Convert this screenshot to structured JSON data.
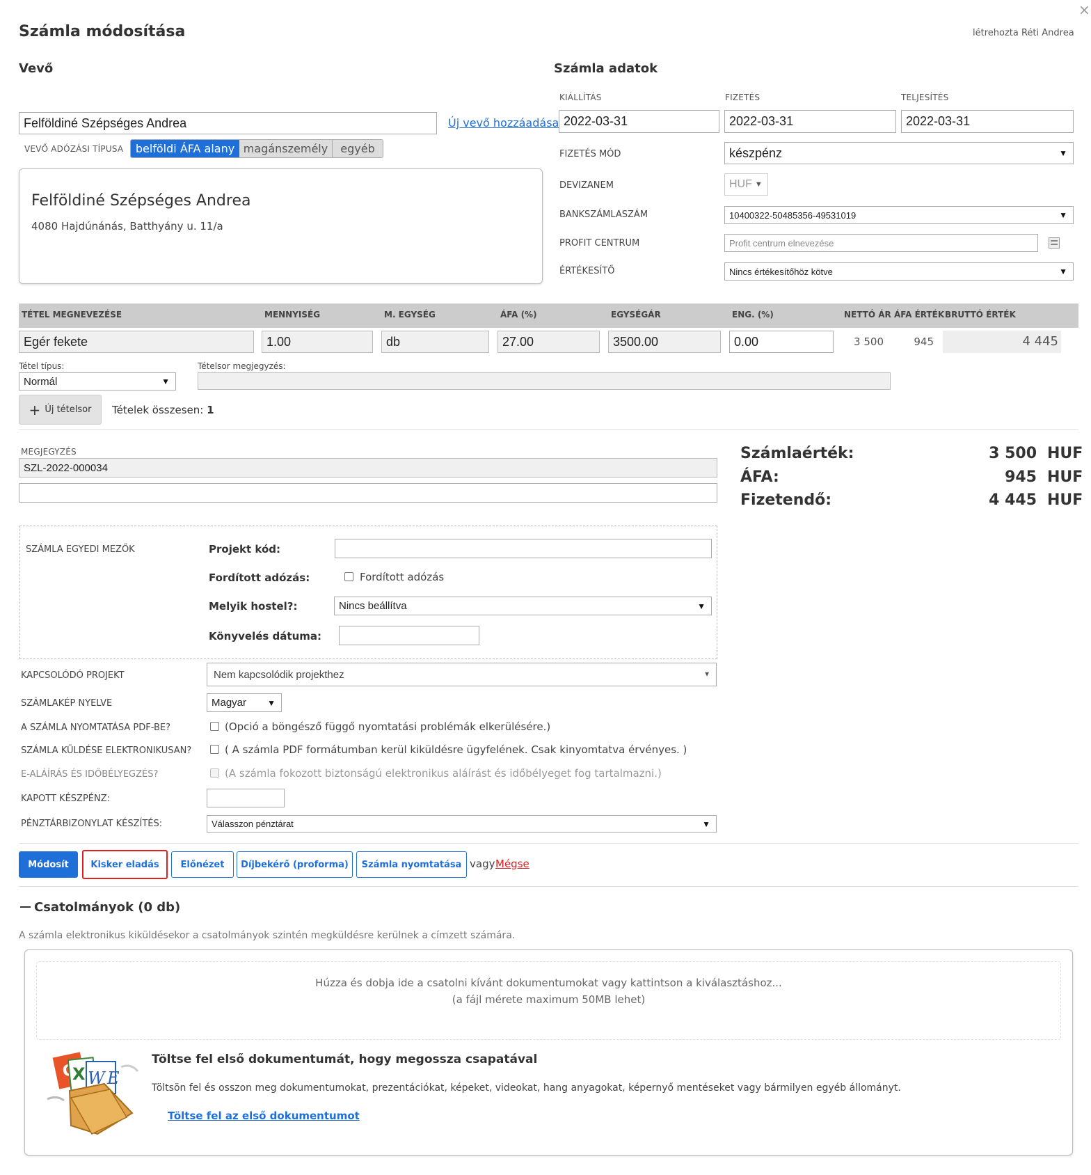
{
  "title": "Számla módosítása",
  "created_by": "létrehozta Réti Andrea",
  "buyer": {
    "section_title": "Vevő",
    "name_value": "Felföldiné Szépséges Andrea",
    "add_new_link": "Új vevő hozzáadása",
    "tax_type_label": "VEVŐ ADÓZÁSI TÍPUSA",
    "tax_types": [
      "belföldi ÁFA alany",
      "magánszemély",
      "egyéb"
    ],
    "card_name": "Felföldiné Szépséges Andrea",
    "card_address": "4080 Hajdúnánás, Batthyány u. 11/a"
  },
  "invoice": {
    "section_title": "Számla adatok",
    "issue_label": "KIÁLLÍTÁS",
    "issue_value": "2022-03-31",
    "payment_label": "FIZETÉS",
    "payment_value": "2022-03-31",
    "fulfil_label": "TELJESÍTÉS",
    "fulfil_value": "2022-03-31",
    "pay_mode_label": "FIZETÉS MÓD",
    "pay_mode_value": "készpénz",
    "currency_label": "DEVIZANEM",
    "currency_value": "HUF",
    "bank_label": "BANKSZÁMLASZÁM",
    "bank_value": "10400322-50485356-49531019",
    "profit_label": "PROFIT CENTRUM",
    "profit_placeholder": "Profit centrum elnevezése",
    "seller_label": "ÉRTÉKESÍTŐ",
    "seller_value": "Nincs értékesítőhöz kötve"
  },
  "items": {
    "headers": [
      "TÉTEL MEGNEVEZÉSE",
      "MENNYISÉG",
      "M. EGYSÉG",
      "ÁFA (%)",
      "EGYSÉGÁR",
      "ENG. (%)",
      "NETTÓ ÁR",
      "ÁFA ÉRTÉK",
      "BRUTTÓ ÉRTÉK"
    ],
    "row": {
      "name": "Egér fekete",
      "qty": "1.00",
      "unit": "db",
      "vat": "27.00",
      "unit_price": "3500.00",
      "discount": "0.00",
      "net": "3 500",
      "vat_amount": "945",
      "gross": "4 445"
    },
    "item_type_label": "Tétel típus:",
    "item_type_value": "Normál",
    "note_label": "Tételsor megjegyzés:",
    "new_row_button": "Új tételsor",
    "total_count_label": "Tételek összesen:",
    "total_count_value": "1"
  },
  "note": {
    "label": "MEGJEGYZÉS",
    "value": "SZL-2022-000034"
  },
  "totals": {
    "invoice_value_label": "Számlaérték:",
    "invoice_value": "3 500",
    "vat_label": "ÁFA:",
    "vat_value": "945",
    "payable_label": "Fizetendő:",
    "payable_value": "4 445",
    "currency": "HUF"
  },
  "custom_fields": {
    "section_label": "SZÁMLA EGYEDI MEZŐK",
    "project_code_label": "Projekt kód:",
    "reverse_tax_label": "Fordított adózás:",
    "reverse_tax_checkbox": "Fordított adózás",
    "hostel_label": "Melyik hostel?:",
    "hostel_value": "Nincs beállítva",
    "booking_date_label": "Könyvelés dátuma:"
  },
  "options": {
    "project_label": "KAPCSOLÓDÓ PROJEKT",
    "project_value": "Nem kapcsolódik projekthez",
    "language_label": "SZÁMLAKÉP NYELVE",
    "language_value": "Magyar",
    "pdf_label": "A SZÁMLA NYOMTATÁSA PDF-BE?",
    "pdf_text": "(Opció a böngésző függő nyomtatási problémák elkerülésére.)",
    "electronic_label": "SZÁMLA KÜLDÉSE ELEKTRONIKUSAN?",
    "electronic_text": "( A számla PDF formátumban kerül kiküldésre ügyfelének. Csak kinyomtatva érvényes. )",
    "esign_label": "E-ALÁÍRÁS ÉS IDŐBÉLYEGZÉS?",
    "esign_text": "(A számla fokozott biztonságú elektronikus aláírást és időbélyeget fog tartalmazni.)",
    "cash_label": "KAPOTT KÉSZPÉNZ:",
    "cashbox_label": "PÉNZTÁRBIZONYLAT KÉSZÍTÉS:",
    "cashbox_value": "Válasszon pénztárat"
  },
  "actions": {
    "modify": "Módosít",
    "retail": "Kisker eladás",
    "preview": "Előnézet",
    "proforma": "Díjbekérő (proforma)",
    "print": "Számla nyomtatása",
    "or": "vagy",
    "cancel": "Mégse"
  },
  "attachments": {
    "title": "Csatolmányok (0 db)",
    "info": "A számla elektronikus kiküldésekor a csatolmányok szintén megküldésre kerülnek a címzett számára.",
    "drop_line1": "Húzza és dobja ide a csatolni kívánt dokumentumokat vagy kattintson a kiválasztáshoz...",
    "drop_line2": "(a fájl mérete maximum 50MB lehet)",
    "promo_title": "Töltse fel első dokumentumát, hogy megossza csapatával",
    "promo_text": "Töltsön fel és osszon meg dokumentumokat, prezentációkat, képeket, videokat, hang anyagokat, képernyő mentéseket vagy bármilyen egyéb állományt.",
    "promo_link": "Töltse fel az első dokumentumot"
  }
}
